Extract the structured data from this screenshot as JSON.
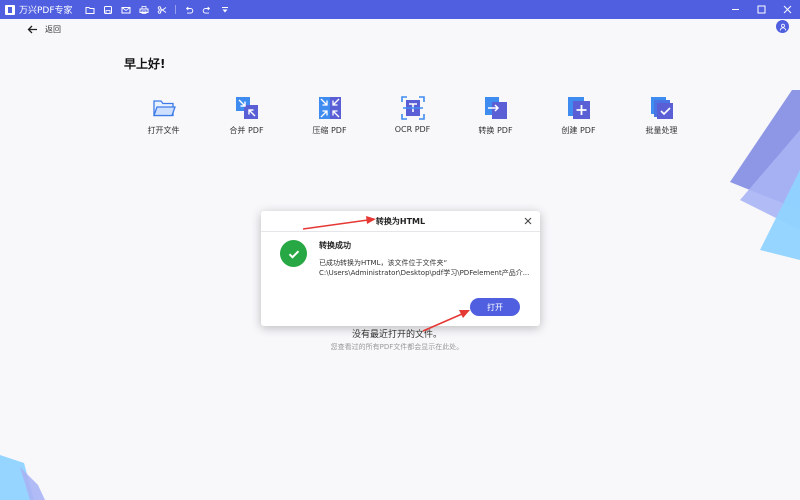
{
  "titlebar": {
    "app_title": "万兴PDF专家",
    "icons": [
      "folder-icon",
      "save-icon",
      "mail-icon",
      "print-icon",
      "scissors-icon",
      "undo-icon",
      "redo-icon",
      "dropdown-icon"
    ],
    "controls": [
      "minimize-icon",
      "maximize-icon",
      "close-icon"
    ]
  },
  "nav": {
    "back_label": "返回"
  },
  "greeting": "早上好!",
  "tools": [
    {
      "label": "打开文件",
      "icon": "open-folder-icon"
    },
    {
      "label": "合并 PDF",
      "icon": "merge-pdf-icon"
    },
    {
      "label": "压缩 PDF",
      "icon": "compress-pdf-icon"
    },
    {
      "label": "OCR PDF",
      "icon": "ocr-pdf-icon"
    },
    {
      "label": "转换 PDF",
      "icon": "convert-pdf-icon"
    },
    {
      "label": "创建 PDF",
      "icon": "create-pdf-icon"
    },
    {
      "label": "批量处理",
      "icon": "batch-process-icon"
    }
  ],
  "empty_state": {
    "title": "没有最近打开的文件。",
    "subtitle": "您查看过的所有PDF文件都会显示在此处。"
  },
  "dialog": {
    "title": "转换为HTML",
    "heading": "转换成功",
    "message": "已成功转换为HTML，该文件位于文件夹“",
    "path": "C:\\Users\\Administrator\\Desktop\\pdf学习\\PDFelement产品介...",
    "open_button": "打开"
  },
  "colors": {
    "accent": "#4f5fe0",
    "success": "#27a845",
    "annotation_arrow": "#e53935"
  }
}
